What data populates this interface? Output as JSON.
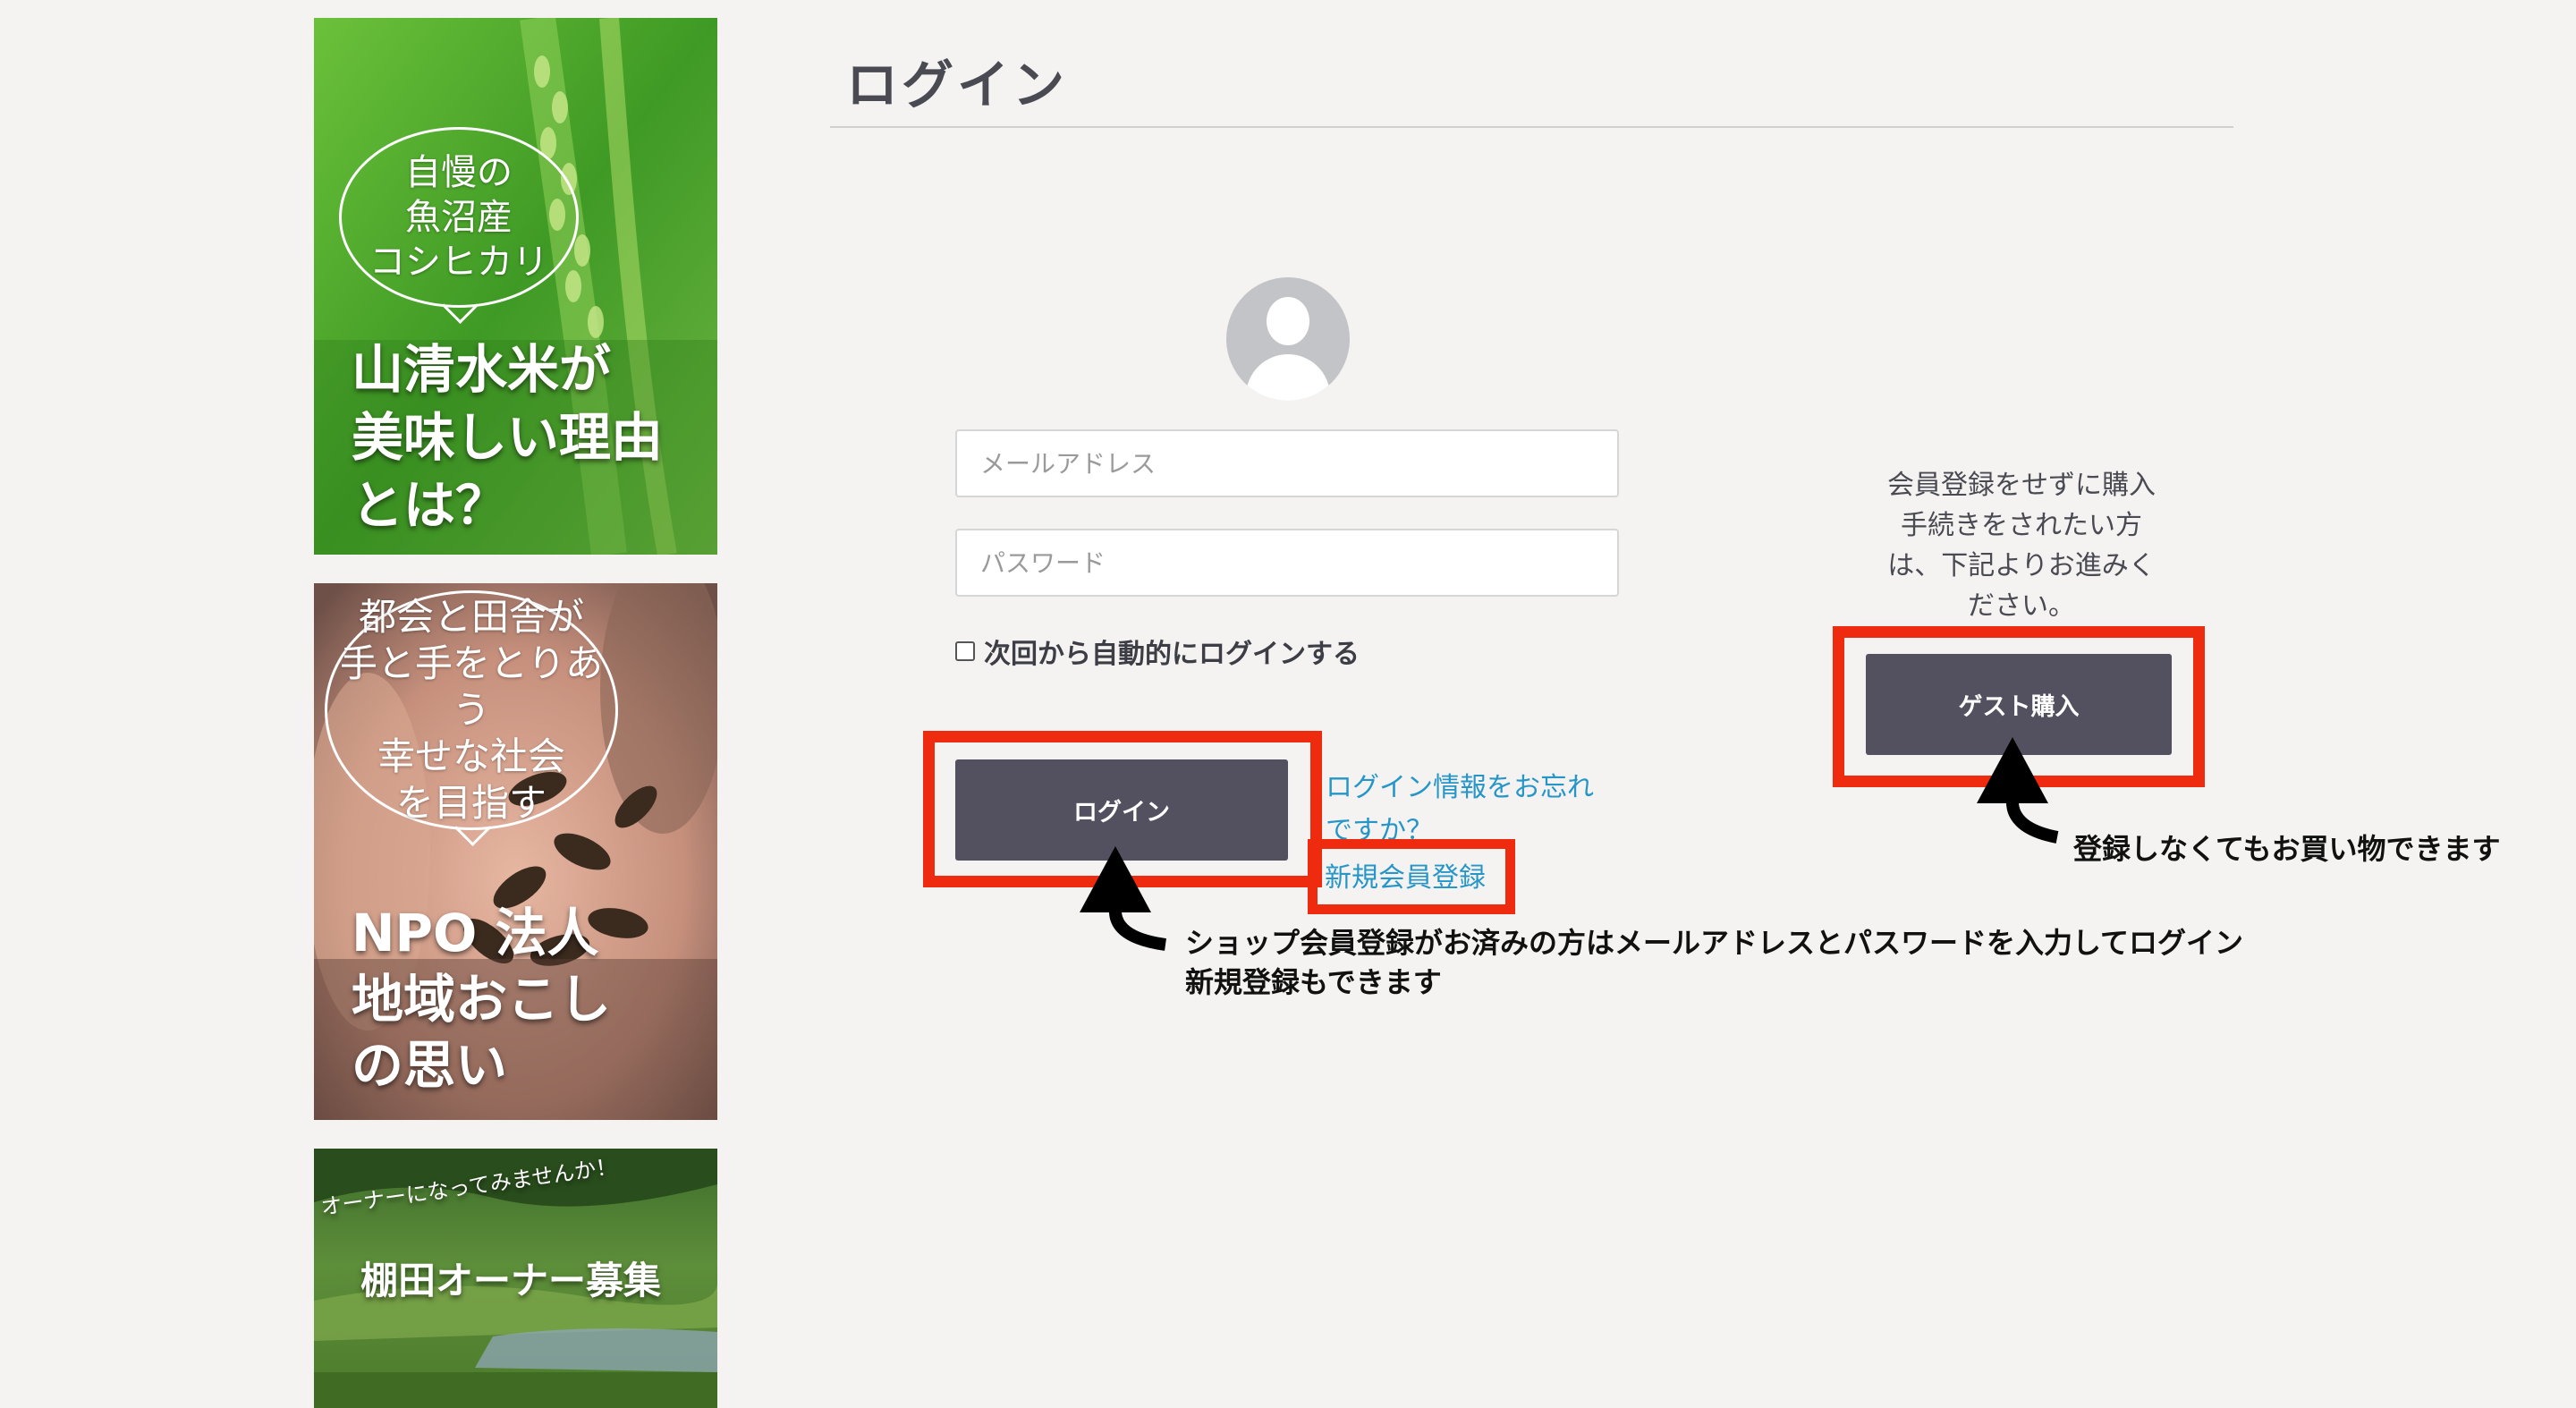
{
  "sidebar": {
    "banner1": {
      "bubble_lines": [
        "自慢の",
        "魚沼産",
        "コシヒカリ"
      ],
      "headline_lines": [
        "山清水米が",
        "美味しい理由",
        "とは？"
      ]
    },
    "banner2": {
      "bubble_lines": [
        "都会と田舎が",
        "手と手をとりあう",
        "幸せな社会",
        "を目指す"
      ],
      "headline_lines": [
        "NPO 法人",
        "地域おこし",
        "の思い"
      ]
    },
    "banner3": {
      "tagline": "オーナーになってみませんか！",
      "headline": "棚田オーナー募集"
    }
  },
  "page": {
    "title": "ログイン"
  },
  "login": {
    "email_placeholder": "メールアドレス",
    "password_placeholder": "パスワード",
    "remember_label": "次回から自動的にログインする",
    "login_button": "ログイン",
    "forgot_line1": "ログイン情報をお忘れ",
    "forgot_line2": "ですか？",
    "register_link": "新規会員登録"
  },
  "guest": {
    "description_lines": [
      "会員登録をせずに購入",
      "手続きをされたい方",
      "は、下記よりお進みく",
      "ださい。"
    ],
    "button": "ゲスト購入"
  },
  "annotations": {
    "login_note_line1": "ショップ会員登録がお済みの方はメールアドレスとパスワードを入力してログイン",
    "login_note_line2": "新規登録もできます",
    "guest_note": "登録しなくてもお買い物できます",
    "highlight_color": "#ee2a0f"
  }
}
